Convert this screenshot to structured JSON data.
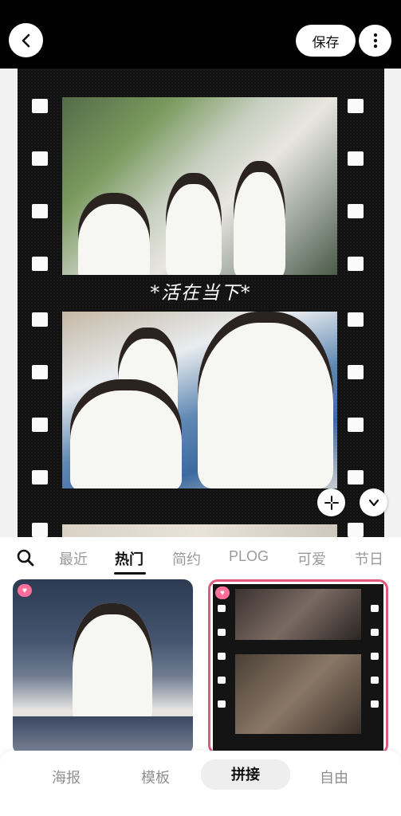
{
  "header": {
    "save_label": "保存",
    "back_icon": "back-arrow-icon",
    "more_icon": "more-vertical-icon"
  },
  "canvas": {
    "caption": "*活在当下*",
    "swap_icon": "sparkle-shrink-icon",
    "collapse_icon": "chevron-down-icon"
  },
  "category_tabs": [
    {
      "label": "最近",
      "active": false
    },
    {
      "label": "热门",
      "active": true
    },
    {
      "label": "简约",
      "active": false
    },
    {
      "label": "PLOG",
      "active": false
    },
    {
      "label": "可爱",
      "active": false
    },
    {
      "label": "节日",
      "active": false
    }
  ],
  "templates": [
    {
      "name": "city-portrait-template",
      "badge": "heart-badge"
    },
    {
      "name": "film-strip-template",
      "badge": "heart-badge",
      "selected": true
    }
  ],
  "bottom_nav": [
    {
      "label": "海报",
      "active": false
    },
    {
      "label": "模板",
      "active": false
    },
    {
      "label": "拼接",
      "active": true
    },
    {
      "label": "自由",
      "active": false
    }
  ],
  "colors": {
    "selected_border": "#e05a7e",
    "heart_badge": "#ff6f9b",
    "film_bg": "#121212"
  }
}
